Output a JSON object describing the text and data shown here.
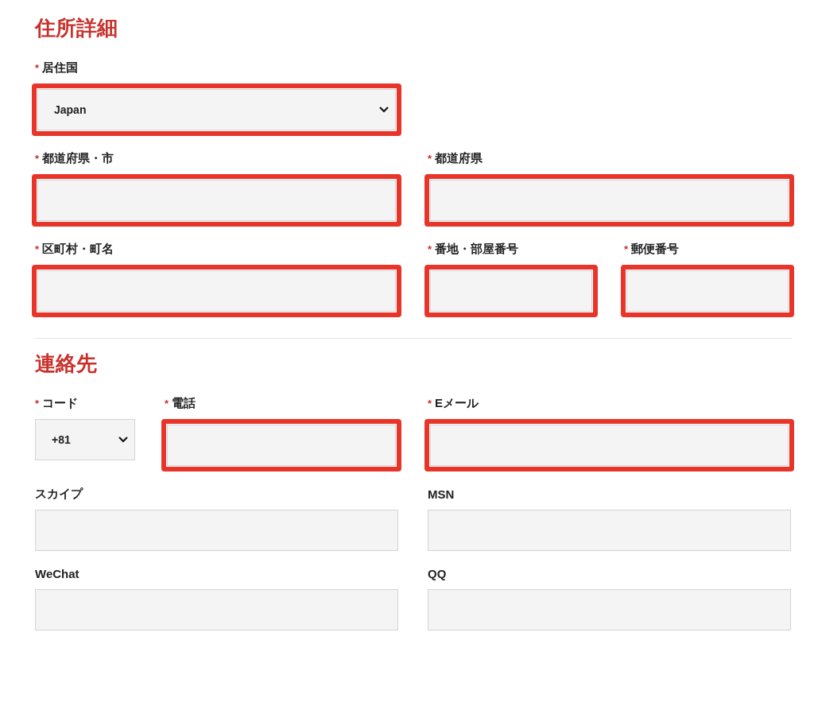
{
  "sections": [
    {
      "title": "住所詳細",
      "rows": [
        [
          {
            "label": "居住国",
            "marker": "*",
            "kind": "select",
            "value": "Japan",
            "highlighted": true
          }
        ],
        [
          {
            "label": "都道府県・市",
            "marker": "*",
            "kind": "text",
            "highlighted": true
          },
          {
            "label": "都道府県",
            "marker": "*",
            "kind": "text",
            "highlighted": true
          }
        ],
        [
          {
            "label": "区町村・町名",
            "marker": "*",
            "kind": "text",
            "highlighted": true
          },
          {
            "label": "番地・部屋番号",
            "marker": "*",
            "kind": "text",
            "highlighted": true
          },
          {
            "label": "郵便番号",
            "marker": "*",
            "kind": "text",
            "highlighted": true
          }
        ]
      ]
    },
    {
      "title": "連絡先",
      "rows": [
        [
          {
            "label": "コード",
            "marker": "*",
            "kind": "select",
            "value": "+81",
            "highlighted": false
          },
          {
            "label": "電話",
            "marker": "*",
            "kind": "text",
            "highlighted": true
          },
          {
            "label": "Eメール",
            "marker": "*",
            "kind": "text",
            "highlighted": true
          }
        ],
        [
          {
            "label": "スカイプ",
            "kind": "text",
            "highlighted": false
          },
          {
            "label": "MSN",
            "kind": "text",
            "highlighted": false
          }
        ],
        [
          {
            "label": "WeChat",
            "kind": "text",
            "highlighted": false
          },
          {
            "label": "QQ",
            "kind": "text",
            "highlighted": false
          }
        ]
      ]
    }
  ]
}
